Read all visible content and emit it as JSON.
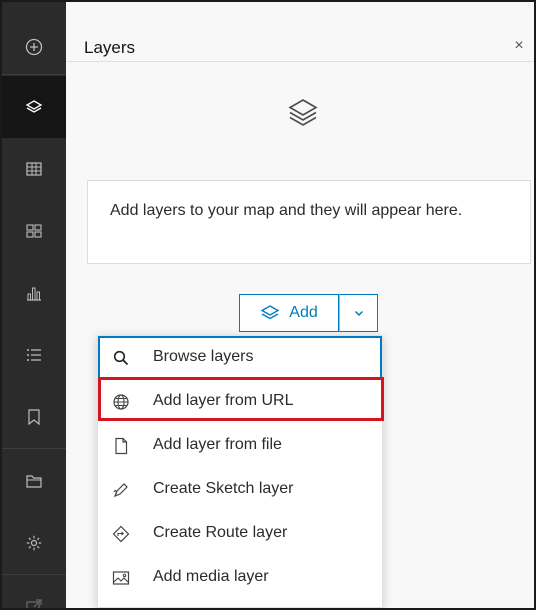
{
  "panel": {
    "title": "Layers",
    "close_glyph": "×",
    "empty_message": "Add layers to your map and they will appear here."
  },
  "actionbar": {
    "items": [
      {
        "icon": "plus-circle-icon"
      },
      {
        "icon": "layers-icon",
        "active": true
      },
      {
        "icon": "table-icon"
      },
      {
        "icon": "legend-icon"
      },
      {
        "icon": "chart-icon"
      },
      {
        "icon": "list-icon"
      },
      {
        "icon": "bookmark-icon"
      },
      {
        "icon": "folder-icon"
      },
      {
        "icon": "gear-icon"
      },
      {
        "icon": "share-icon"
      }
    ]
  },
  "add_button": {
    "label": "Add"
  },
  "menu": {
    "items": [
      {
        "label": "Browse layers",
        "icon": "search-icon"
      },
      {
        "label": "Add layer from URL",
        "icon": "globe-icon"
      },
      {
        "label": "Add layer from file",
        "icon": "file-icon"
      },
      {
        "label": "Create Sketch layer",
        "icon": "sketch-icon"
      },
      {
        "label": "Create Route layer",
        "icon": "route-icon"
      },
      {
        "label": "Add media layer",
        "icon": "image-icon"
      }
    ]
  },
  "colors": {
    "accent": "#007ac2",
    "highlight": "#d6141c",
    "actionbar_bg": "#2b2b2b"
  }
}
